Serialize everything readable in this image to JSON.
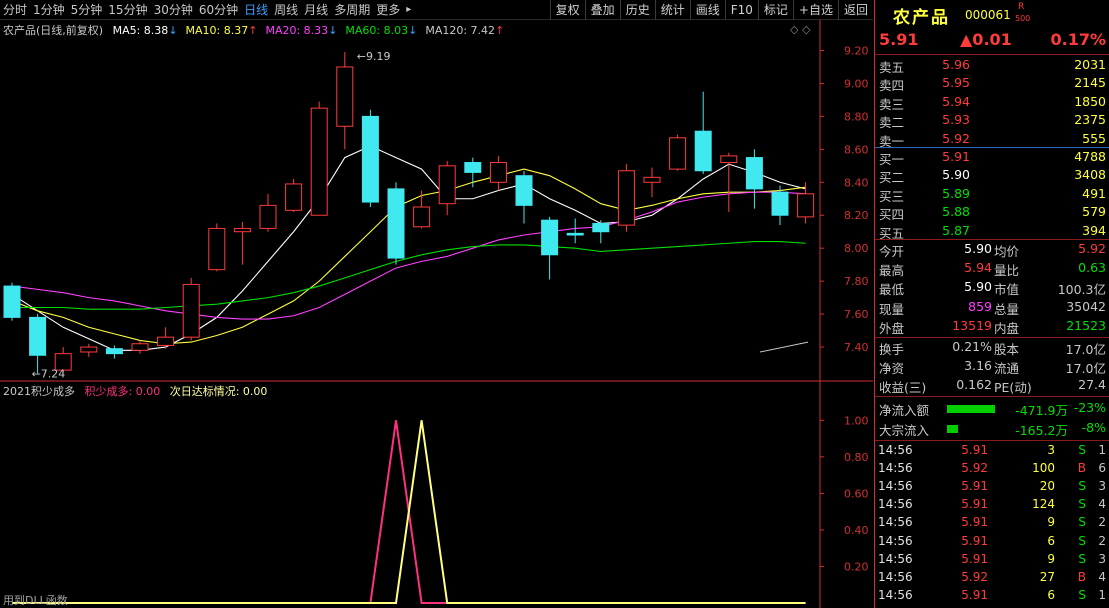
{
  "toolbar": {
    "periods": [
      "分时",
      "1分钟",
      "5分钟",
      "15分钟",
      "30分钟",
      "60分钟",
      "日线",
      "周线",
      "月线",
      "多周期",
      "更多"
    ],
    "active": "日线",
    "more_arrow": "▸",
    "tools": [
      "复权",
      "叠加",
      "历史",
      "统计",
      "画线",
      "F10",
      "标记",
      "+自选",
      "返回"
    ]
  },
  "main": {
    "title": "农产品(日线,前复权)",
    "ma": [
      {
        "label": "MA5: 8.38",
        "arrow": "↓",
        "color": "#ffffff"
      },
      {
        "label": "MA10: 8.37",
        "arrow": "↑",
        "color": "#ffff40"
      },
      {
        "label": "MA20: 8.33",
        "arrow": "↓",
        "color": "#ff40ff"
      },
      {
        "label": "MA60: 8.03",
        "arrow": "↓",
        "color": "#00e000"
      },
      {
        "label": "MA120: 7.42",
        "arrow": "↑",
        "color": "#c8c8c8"
      }
    ],
    "y_ticks": [
      "9.20",
      "9.00",
      "8.80",
      "8.60",
      "8.40",
      "8.20",
      "8.00",
      "7.80",
      "7.60",
      "7.40"
    ],
    "high_label": "9.19",
    "low_label": "7.24"
  },
  "sub": {
    "title": "2021积少成多",
    "series1_label": "积少成多: 0.00",
    "series2_label": "次日达标情况: 0.00",
    "y_ticks": [
      "1.00",
      "0.80",
      "0.60",
      "0.40",
      "0.20"
    ],
    "bottom_note": "用到DLL函数"
  },
  "chart_data": {
    "type": "candlestick",
    "ylim": [
      7.2,
      9.3
    ],
    "candles": [
      {
        "o": 7.77,
        "c": 7.58,
        "h": 7.79,
        "l": 7.56
      },
      {
        "o": 7.58,
        "c": 7.35,
        "h": 7.6,
        "l": 7.24
      },
      {
        "o": 7.26,
        "c": 7.36,
        "h": 7.4,
        "l": 7.24
      },
      {
        "o": 7.37,
        "c": 7.4,
        "h": 7.42,
        "l": 7.34
      },
      {
        "o": 7.39,
        "c": 7.36,
        "h": 7.41,
        "l": 7.33
      },
      {
        "o": 7.38,
        "c": 7.42,
        "h": 7.44,
        "l": 7.36
      },
      {
        "o": 7.41,
        "c": 7.46,
        "h": 7.52,
        "l": 7.39
      },
      {
        "o": 7.46,
        "c": 7.78,
        "h": 7.82,
        "l": 7.44
      },
      {
        "o": 7.87,
        "c": 8.12,
        "h": 8.15,
        "l": 7.86
      },
      {
        "o": 8.1,
        "c": 8.12,
        "h": 8.16,
        "l": 7.9
      },
      {
        "o": 8.12,
        "c": 8.26,
        "h": 8.33,
        "l": 8.1
      },
      {
        "o": 8.23,
        "c": 8.39,
        "h": 8.42,
        "l": 8.22
      },
      {
        "o": 8.2,
        "c": 8.85,
        "h": 8.89,
        "l": 8.55
      },
      {
        "o": 8.74,
        "c": 9.1,
        "h": 9.19,
        "l": 8.6
      },
      {
        "o": 8.8,
        "c": 8.28,
        "h": 8.84,
        "l": 8.25
      },
      {
        "o": 8.36,
        "c": 7.94,
        "h": 8.4,
        "l": 7.9
      },
      {
        "o": 8.13,
        "c": 8.25,
        "h": 8.35,
        "l": 8.12
      },
      {
        "o": 8.27,
        "c": 8.5,
        "h": 8.53,
        "l": 8.2
      },
      {
        "o": 8.52,
        "c": 8.46,
        "h": 8.55,
        "l": 8.37
      },
      {
        "o": 8.4,
        "c": 8.52,
        "h": 8.56,
        "l": 8.35
      },
      {
        "o": 8.44,
        "c": 8.26,
        "h": 8.47,
        "l": 8.15
      },
      {
        "o": 8.17,
        "c": 7.96,
        "h": 8.19,
        "l": 7.81
      },
      {
        "o": 8.09,
        "c": 8.08,
        "h": 8.18,
        "l": 8.03
      },
      {
        "o": 8.15,
        "c": 8.1,
        "h": 8.17,
        "l": 8.03
      },
      {
        "o": 8.14,
        "c": 8.47,
        "h": 8.51,
        "l": 8.1
      },
      {
        "o": 8.4,
        "c": 8.43,
        "h": 8.49,
        "l": 8.31
      },
      {
        "o": 8.48,
        "c": 8.67,
        "h": 8.69,
        "l": 8.47
      },
      {
        "o": 8.71,
        "c": 8.47,
        "h": 8.95,
        "l": 8.45
      },
      {
        "o": 8.52,
        "c": 8.56,
        "h": 8.58,
        "l": 8.22
      },
      {
        "o": 8.55,
        "c": 8.36,
        "h": 8.6,
        "l": 8.24
      },
      {
        "o": 8.34,
        "c": 8.2,
        "h": 8.38,
        "l": 8.14
      },
      {
        "o": 8.19,
        "c": 8.33,
        "h": 8.4,
        "l": 8.15
      }
    ],
    "ma_series": [
      {
        "name": "MA5",
        "values": [
          7.72,
          7.62,
          7.52,
          7.45,
          7.38,
          7.38,
          7.4,
          7.48,
          7.58,
          7.74,
          7.92,
          8.1,
          8.3,
          8.55,
          8.62,
          8.55,
          8.48,
          8.3,
          8.3,
          8.35,
          8.39,
          8.3,
          8.23,
          8.15,
          8.16,
          8.2,
          8.3,
          8.42,
          8.51,
          8.46,
          8.4,
          8.36
        ]
      },
      {
        "name": "MA10",
        "values": [
          7.68,
          7.62,
          7.58,
          7.52,
          7.48,
          7.44,
          7.42,
          7.43,
          7.47,
          7.52,
          7.6,
          7.68,
          7.8,
          7.95,
          8.1,
          8.25,
          8.32,
          8.35,
          8.4,
          8.44,
          8.48,
          8.44,
          8.36,
          8.27,
          8.23,
          8.26,
          8.3,
          8.33,
          8.34,
          8.34,
          8.35,
          8.37
        ]
      },
      {
        "name": "MA20",
        "values": [
          7.77,
          7.75,
          7.73,
          7.7,
          7.68,
          7.65,
          7.62,
          7.6,
          7.58,
          7.57,
          7.57,
          7.59,
          7.64,
          7.72,
          7.8,
          7.88,
          7.92,
          7.95,
          8.0,
          8.05,
          8.08,
          8.1,
          8.12,
          8.13,
          8.17,
          8.22,
          8.28,
          8.31,
          8.33,
          8.34,
          8.34,
          8.33
        ]
      },
      {
        "name": "MA60",
        "values": [
          7.64,
          7.64,
          7.64,
          7.63,
          7.63,
          7.63,
          7.64,
          7.65,
          7.66,
          7.68,
          7.7,
          7.73,
          7.77,
          7.82,
          7.87,
          7.92,
          7.96,
          7.99,
          8.01,
          8.02,
          8.02,
          8.01,
          8.0,
          7.98,
          7.99,
          8.0,
          8.01,
          8.02,
          8.03,
          8.04,
          8.04,
          8.03
        ]
      }
    ],
    "signals": [
      {
        "name": "积少成多",
        "color": "#ff3080",
        "values": [
          0,
          0,
          0,
          0,
          0,
          0,
          0,
          0,
          0,
          0,
          0,
          0,
          0,
          0,
          0,
          1,
          0,
          0,
          0,
          0,
          0,
          0,
          0,
          0,
          0,
          0,
          0,
          0,
          0,
          0,
          0,
          0
        ]
      },
      {
        "name": "次日达标情况",
        "color": "#ffff80",
        "values": [
          0,
          0,
          0,
          0,
          0,
          0,
          0,
          0,
          0,
          0,
          0,
          0,
          0,
          0,
          0,
          0,
          1,
          0,
          0,
          0,
          0,
          0,
          0,
          0,
          0,
          0,
          0,
          0,
          0,
          0,
          0,
          0
        ]
      }
    ],
    "sub_ylim": [
      0,
      1.1
    ]
  },
  "quote": {
    "name": "农产品",
    "code": "000061",
    "r_mark": "R",
    "sub_mark": "500",
    "price": "5.91",
    "change": "▲0.01",
    "pct": "0.17%",
    "sell": [
      {
        "label": "卖五",
        "price": "5.96",
        "vol": "2031"
      },
      {
        "label": "卖四",
        "price": "5.95",
        "vol": "2145"
      },
      {
        "label": "卖三",
        "price": "5.94",
        "vol": "1850"
      },
      {
        "label": "卖二",
        "price": "5.93",
        "vol": "2375"
      },
      {
        "label": "卖一",
        "price": "5.92",
        "vol": "555"
      }
    ],
    "buy": [
      {
        "label": "买一",
        "price": "5.91",
        "vol": "4788",
        "pc": "red"
      },
      {
        "label": "买二",
        "price": "5.90",
        "vol": "3408",
        "pc": "white"
      },
      {
        "label": "买三",
        "price": "5.89",
        "vol": "491",
        "pc": "green"
      },
      {
        "label": "买四",
        "price": "5.88",
        "vol": "579",
        "pc": "green"
      },
      {
        "label": "买五",
        "price": "5.87",
        "vol": "394",
        "pc": "green"
      }
    ],
    "stats": [
      {
        "l1": "今开",
        "v1": "5.90",
        "c1": "white",
        "l2": "均价",
        "v2": "5.92",
        "c2": "red"
      },
      {
        "l1": "最高",
        "v1": "5.94",
        "c1": "red",
        "l2": "量比",
        "v2": "0.63",
        "c2": "green"
      },
      {
        "l1": "最低",
        "v1": "5.90",
        "c1": "white",
        "l2": "市值",
        "v2": "100.3亿",
        "c2": "gray"
      },
      {
        "l1": "现量",
        "v1": "859",
        "c1": "magenta",
        "l2": "总量",
        "v2": "35042",
        "c2": "gray"
      },
      {
        "l1": "外盘",
        "v1": "13519",
        "c1": "red",
        "l2": "内盘",
        "v2": "21523",
        "c2": "green"
      }
    ],
    "fund": [
      {
        "l1": "换手",
        "v1": "0.21%",
        "l2": "股本",
        "v2": "17.0亿"
      },
      {
        "l1": "净资",
        "v1": "3.16",
        "l2": "流通",
        "v2": "17.0亿"
      },
      {
        "l1": "收益(三)",
        "v1": "0.162",
        "l2": "PE(动)",
        "v2": "27.4"
      }
    ],
    "flow": [
      {
        "label": "净流入额",
        "bar": 0.85,
        "value": "-471.9万",
        "pct": "-23%"
      },
      {
        "label": "大宗流入",
        "bar": 0.2,
        "value": "-165.2万",
        "pct": "-8%"
      }
    ],
    "ticks": [
      {
        "t": "14:56",
        "p": "5.91",
        "pc": "red",
        "v": "3",
        "vc": "yellow",
        "s": "S",
        "sc": "green",
        "n": "1"
      },
      {
        "t": "14:56",
        "p": "5.92",
        "pc": "red",
        "v": "100",
        "vc": "yellow",
        "s": "B",
        "sc": "red",
        "n": "6"
      },
      {
        "t": "14:56",
        "p": "5.91",
        "pc": "red",
        "v": "20",
        "vc": "yellow",
        "s": "S",
        "sc": "green",
        "n": "3"
      },
      {
        "t": "14:56",
        "p": "5.91",
        "pc": "red",
        "v": "124",
        "vc": "yellow",
        "s": "S",
        "sc": "green",
        "n": "4"
      },
      {
        "t": "14:56",
        "p": "5.91",
        "pc": "red",
        "v": "9",
        "vc": "yellow",
        "s": "S",
        "sc": "green",
        "n": "2"
      },
      {
        "t": "14:56",
        "p": "5.91",
        "pc": "red",
        "v": "6",
        "vc": "yellow",
        "s": "S",
        "sc": "green",
        "n": "2"
      },
      {
        "t": "14:56",
        "p": "5.91",
        "pc": "red",
        "v": "9",
        "vc": "yellow",
        "s": "S",
        "sc": "green",
        "n": "3"
      },
      {
        "t": "14:56",
        "p": "5.92",
        "pc": "red",
        "v": "27",
        "vc": "yellow",
        "s": "B",
        "sc": "red",
        "n": "4"
      },
      {
        "t": "14:56",
        "p": "5.91",
        "pc": "red",
        "v": "6",
        "vc": "yellow",
        "s": "S",
        "sc": "green",
        "n": "1"
      }
    ]
  }
}
